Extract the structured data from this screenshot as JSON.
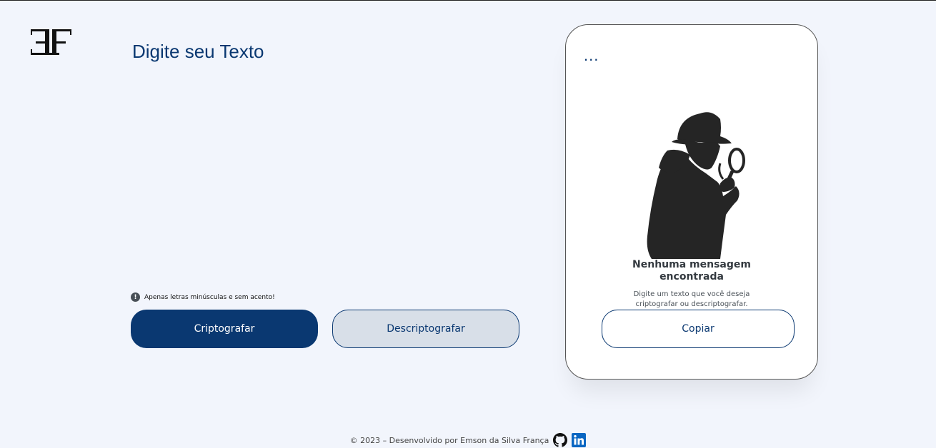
{
  "app": {
    "logo_text": "EF"
  },
  "input": {
    "placeholder": "Digite seu Texto"
  },
  "hint": {
    "icon": "info-icon",
    "text": "Apenas letras minúsculas e sem acento!"
  },
  "buttons": {
    "encrypt_label": "Criptografar",
    "decrypt_label": "Descriptografar"
  },
  "output": {
    "menu_label": "...",
    "image": "detective-with-magnifier",
    "title_line1": "Nenhuma mensagem",
    "title_line2": "encontrada",
    "desc_line1": "Digite um texto que você deseja",
    "desc_line2": "criptografar ou descriptografar.",
    "copy_label": "Copiar"
  },
  "footer": {
    "text": "© 2023 – Desenvolvido por Emson da Silva França",
    "icons": [
      "github-icon",
      "linkedin-icon"
    ]
  },
  "colors": {
    "primary": "#0a3871",
    "background": "#f2f5fc",
    "secondary_button": "#d8dfe8"
  }
}
